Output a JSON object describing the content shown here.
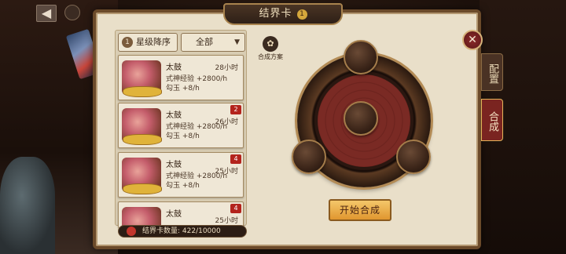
{
  "header": {
    "title": "结界卡",
    "info_icon": "1"
  },
  "list": {
    "sort_label": "星级降序",
    "sort_num": "1",
    "filter_label": "全部",
    "filter_arrow": "▼",
    "cards": [
      {
        "name": "太鼓",
        "time": "28小时",
        "exp": "式神经验 +2800/h",
        "jade": "勾玉 +8/h",
        "count": ""
      },
      {
        "name": "太鼓",
        "time": "26小时",
        "exp": "式神经验 +2800/h",
        "jade": "勾玉 +8/h",
        "count": "2"
      },
      {
        "name": "太鼓",
        "time": "25小时",
        "exp": "式神经验 +2800/h",
        "jade": "勾玉 +8/h",
        "count": "4"
      },
      {
        "name": "太鼓",
        "time": "25小时",
        "exp": "",
        "jade": "",
        "count": "4"
      }
    ],
    "card_count_text": "结界卡数量: 422/10000"
  },
  "synth": {
    "recipe_label": "合成方案",
    "start_label": "开始合成"
  },
  "tabs": {
    "config": "配置",
    "synth": "合成"
  },
  "nav": {
    "back": "◀",
    "close": "✕"
  },
  "colors": {
    "accent": "#e0962f",
    "panel": "#e9dfc9",
    "active_tab": "#7a2420"
  }
}
